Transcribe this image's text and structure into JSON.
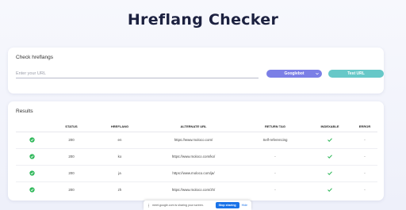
{
  "page": {
    "title": "Hreflang Checker"
  },
  "check_card": {
    "label": "Check hreflangs",
    "input_placeholder": "Enter your URL",
    "input_value": "",
    "user_agent_selected": "Googlebot",
    "test_button_label": "Test URL"
  },
  "results": {
    "label": "Results",
    "columns": [
      "",
      "STATUS",
      "HREFLANG",
      "ALTERNATE URL",
      "RETURN TAG",
      "INDEXABLE",
      "ERROR"
    ],
    "rows": [
      {
        "status": "200",
        "hreflang": "en",
        "alternate_url": "https://www.moloco.com/",
        "return_tag": "Self-referencing",
        "indexable": "check-icon",
        "error": "-"
      },
      {
        "status": "200",
        "hreflang": "ko",
        "alternate_url": "https://www.moloco.com/ko/",
        "return_tag": "-",
        "indexable": "check-icon",
        "error": "-"
      },
      {
        "status": "200",
        "hreflang": "ja",
        "alternate_url": "https://www.moloco.com/ja/",
        "return_tag": "-",
        "indexable": "check-icon",
        "error": "-"
      },
      {
        "status": "200",
        "hreflang": "zh",
        "alternate_url": "https://www.moloco.com/zh/",
        "return_tag": "-",
        "indexable": "check-icon",
        "error": "-"
      }
    ]
  },
  "share_bar": {
    "text": "meet.google.com is sharing your screen.",
    "stop_label": "Stop sharing",
    "hide_label": "Hide"
  },
  "colors": {
    "accent_purple": "#7b7fe6",
    "accent_teal": "#67c8c8",
    "success_green": "#2fb85a",
    "title_navy": "#1c2140"
  }
}
